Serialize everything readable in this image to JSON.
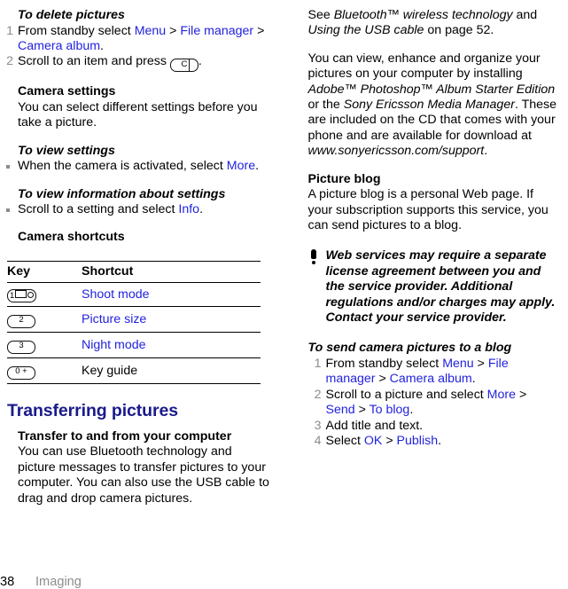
{
  "colors": {
    "link": "#2222dd",
    "heading_navy": "#1a1a8c",
    "step_number_gray": "#8c8c8c",
    "bullet_gray": "#8c8c8c",
    "text": "#000000",
    "background": "#ffffff"
  },
  "left_column": {
    "section_delete": {
      "heading": "To delete pictures",
      "steps": [
        {
          "number": "1",
          "parts": [
            {
              "t": "text",
              "v": "From standby select "
            },
            {
              "t": "link",
              "v": "Menu"
            },
            {
              "t": "text",
              "v": " > "
            },
            {
              "t": "link",
              "v": "File manager"
            },
            {
              "t": "text",
              "v": " > "
            },
            {
              "t": "link",
              "v": "Camera album"
            },
            {
              "t": "text",
              "v": "."
            }
          ]
        },
        {
          "number": "2",
          "parts": [
            {
              "t": "text",
              "v": "Scroll to an item and press "
            },
            {
              "t": "key",
              "v": "C"
            },
            {
              "t": "text",
              "v": "."
            }
          ]
        }
      ]
    },
    "section_camera_settings": {
      "heading": "Camera settings",
      "body": "You can select different settings before you take a picture."
    },
    "section_view_settings": {
      "heading": "To view settings",
      "bullets": [
        {
          "parts": [
            {
              "t": "text",
              "v": "When the camera is activated, select "
            },
            {
              "t": "link",
              "v": "More"
            },
            {
              "t": "text",
              "v": "."
            }
          ]
        }
      ]
    },
    "section_view_info": {
      "heading": "To view information about settings",
      "bullets": [
        {
          "parts": [
            {
              "t": "text",
              "v": "Scroll to a setting and select "
            },
            {
              "t": "link",
              "v": "Info"
            },
            {
              "t": "text",
              "v": "."
            }
          ]
        }
      ]
    },
    "shortcuts": {
      "heading": "Camera shortcuts",
      "columns": [
        "Key",
        "Shortcut"
      ],
      "rows": [
        {
          "key_glyph": "1-envelope",
          "key_label": "1",
          "action": "Shoot mode",
          "action_is_link": true
        },
        {
          "key_glyph": "2",
          "key_label": "2",
          "action": "Picture size",
          "action_is_link": true
        },
        {
          "key_glyph": "3",
          "key_label": "3",
          "action": "Night mode",
          "action_is_link": true
        },
        {
          "key_glyph": "0-plus",
          "key_label": "0 +",
          "action": "Key guide",
          "action_is_link": false
        }
      ]
    },
    "section_transferring": {
      "heading": "Transferring pictures",
      "subheading": "Transfer to and from your computer",
      "body": "You can use Bluetooth technology and picture messages to transfer pictures to your computer. You can also use the USB cable to drag and drop camera pictures."
    }
  },
  "right_column": {
    "see_reference": {
      "parts": [
        {
          "t": "text",
          "v": "See "
        },
        {
          "t": "italic",
          "v": "Bluetooth™ wireless technology"
        },
        {
          "t": "text",
          "v": " and "
        },
        {
          "t": "italic",
          "v": "Using the USB cable"
        },
        {
          "t": "text",
          "v": " on page 52."
        }
      ]
    },
    "software_paragraph": {
      "parts": [
        {
          "t": "text",
          "v": "You can view, enhance and organize your pictures on your computer by installing "
        },
        {
          "t": "italic",
          "v": "Adobe™ Photoshop™ Album Starter Edition"
        },
        {
          "t": "text",
          "v": " or the "
        },
        {
          "t": "italic",
          "v": "Sony Ericsson Media Manager"
        },
        {
          "t": "text",
          "v": ". These are included on the CD that comes with your phone and are available for download at "
        },
        {
          "t": "italic",
          "v": "www.sonyericsson.com/support"
        },
        {
          "t": "text",
          "v": "."
        }
      ]
    },
    "section_picture_blog": {
      "heading": "Picture blog",
      "body": "A picture blog is a personal Web page. If your subscription supports this service, you can send pictures to a blog."
    },
    "note": {
      "icon": "exclamation-icon",
      "text": "Web services may require a separate license agreement between you and the service provider. Additional regulations and/or charges may apply. Contact your service provider."
    },
    "section_send_to_blog": {
      "heading": "To send camera pictures to a blog",
      "steps": [
        {
          "number": "1",
          "parts": [
            {
              "t": "text",
              "v": "From standby select "
            },
            {
              "t": "link",
              "v": "Menu"
            },
            {
              "t": "text",
              "v": " > "
            },
            {
              "t": "link",
              "v": "File manager"
            },
            {
              "t": "text",
              "v": " > "
            },
            {
              "t": "link",
              "v": "Camera album"
            },
            {
              "t": "text",
              "v": "."
            }
          ]
        },
        {
          "number": "2",
          "parts": [
            {
              "t": "text",
              "v": "Scroll to a picture and select "
            },
            {
              "t": "link",
              "v": "More"
            },
            {
              "t": "text",
              "v": " > "
            },
            {
              "t": "link",
              "v": "Send"
            },
            {
              "t": "text",
              "v": " > "
            },
            {
              "t": "link",
              "v": "To blog"
            },
            {
              "t": "text",
              "v": "."
            }
          ]
        },
        {
          "number": "3",
          "parts": [
            {
              "t": "text",
              "v": "Add title and text."
            }
          ]
        },
        {
          "number": "4",
          "parts": [
            {
              "t": "text",
              "v": "Select "
            },
            {
              "t": "link",
              "v": "OK"
            },
            {
              "t": "text",
              "v": " > "
            },
            {
              "t": "link",
              "v": "Publish"
            },
            {
              "t": "text",
              "v": "."
            }
          ]
        }
      ]
    }
  },
  "footer": {
    "page_number": "38",
    "section_name": "Imaging"
  }
}
